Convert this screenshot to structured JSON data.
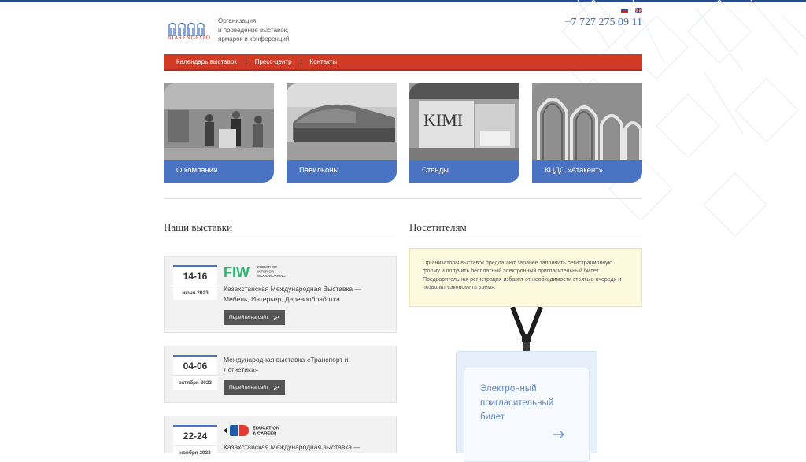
{
  "header": {
    "logo_text": "ATAKENT-EXPO",
    "tagline_line1": "Организация",
    "tagline_line2": "и проведение выставок,",
    "tagline_line3": "ярмарок и конференций",
    "phone": "+7 727 275 09 11",
    "flags": [
      "flag-ru-icon",
      "flag-uk-icon"
    ]
  },
  "nav": {
    "items": [
      "Календарь выставок",
      "Пресс-центр",
      "Контакты"
    ]
  },
  "tiles": [
    {
      "label": "О компании"
    },
    {
      "label": "Павильоны"
    },
    {
      "label": "Стенды"
    },
    {
      "label": "КЦДС «Атакент»"
    }
  ],
  "exhibitions": {
    "heading": "Наши выставки",
    "cards": [
      {
        "days": "14-16",
        "month": "июня 2023",
        "logo": "FIW",
        "logo_sub1": "FURNITURE",
        "logo_sub2": "INTERIOR",
        "logo_sub3": "WOODWORKING",
        "title": "Казахстанская Международная Выставка — Мебель, Интерьер, Деревообработка",
        "button": "Перейти на сайт"
      },
      {
        "days": "04-06",
        "month": "октября 2023",
        "title": "Международная выставка «Транспорт и Логистика»",
        "button": "Перейти на сайт"
      },
      {
        "days": "22-24",
        "month": "ноября 2023",
        "logo_sub1": "EDUCATION",
        "logo_sub2": "& CAREER",
        "title": "Казахстанская Международная выставка —"
      }
    ]
  },
  "visitors": {
    "heading": "Посетителям",
    "notice": "Организаторы выставок предлагают заранее заполнить регистрационную форму и получить бесплатный электронный пригласительный билет. Предварительная регистрация избавит от необходимости стоять в очереди и позволит сэкономить время.",
    "ticket_text": "Электронный пригласительный билет"
  },
  "colors": {
    "nav_red": "#d03a27",
    "accent_blue": "#4a73c3",
    "phone_blue": "#3e6db5",
    "notice_bg": "#fdf9df"
  }
}
